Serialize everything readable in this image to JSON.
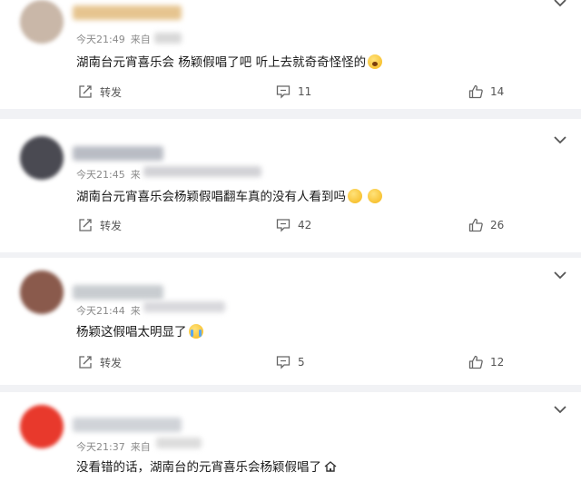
{
  "comments": [
    {
      "time": "今天21:49",
      "source": "来自",
      "text": "湖南台元宵喜乐会 杨颖假唱了吧  听上去就奇奇怪怪的",
      "emojis": [
        "gasp"
      ],
      "repost_label": "转发",
      "comment_count": "11",
      "like_count": "14",
      "avatar_color": "#c9b7a8",
      "name_color": "#e6c48f"
    },
    {
      "time": "今天21:45",
      "source": "来",
      "text": "湖南台元宵喜乐会杨颖假唱翻车真的没有人看到吗",
      "emojis": [
        "yellow",
        "yellow"
      ],
      "repost_label": "转发",
      "comment_count": "42",
      "like_count": "26",
      "avatar_color": "#4a4a52",
      "name_color": "#b9bcc4"
    },
    {
      "time": "今天21:44",
      "source": "来",
      "text": "杨颖这假唱太明显了",
      "emojis": [
        "cry"
      ],
      "repost_label": "转发",
      "comment_count": "5",
      "like_count": "12",
      "avatar_color": "#8a5a4c",
      "name_color": "#c8ccd0"
    },
    {
      "time": "今天21:37",
      "source": "来自",
      "text": "没看错的话，湖南台的元宵喜乐会杨颖假唱了",
      "emojis": [
        "house"
      ],
      "avatar_color": "#e8392c",
      "name_color": "#d0d3d8"
    }
  ],
  "icons": {
    "repost": "repost-icon",
    "comment": "comment-icon",
    "like": "like-icon",
    "menu": "chevron-down-icon"
  }
}
